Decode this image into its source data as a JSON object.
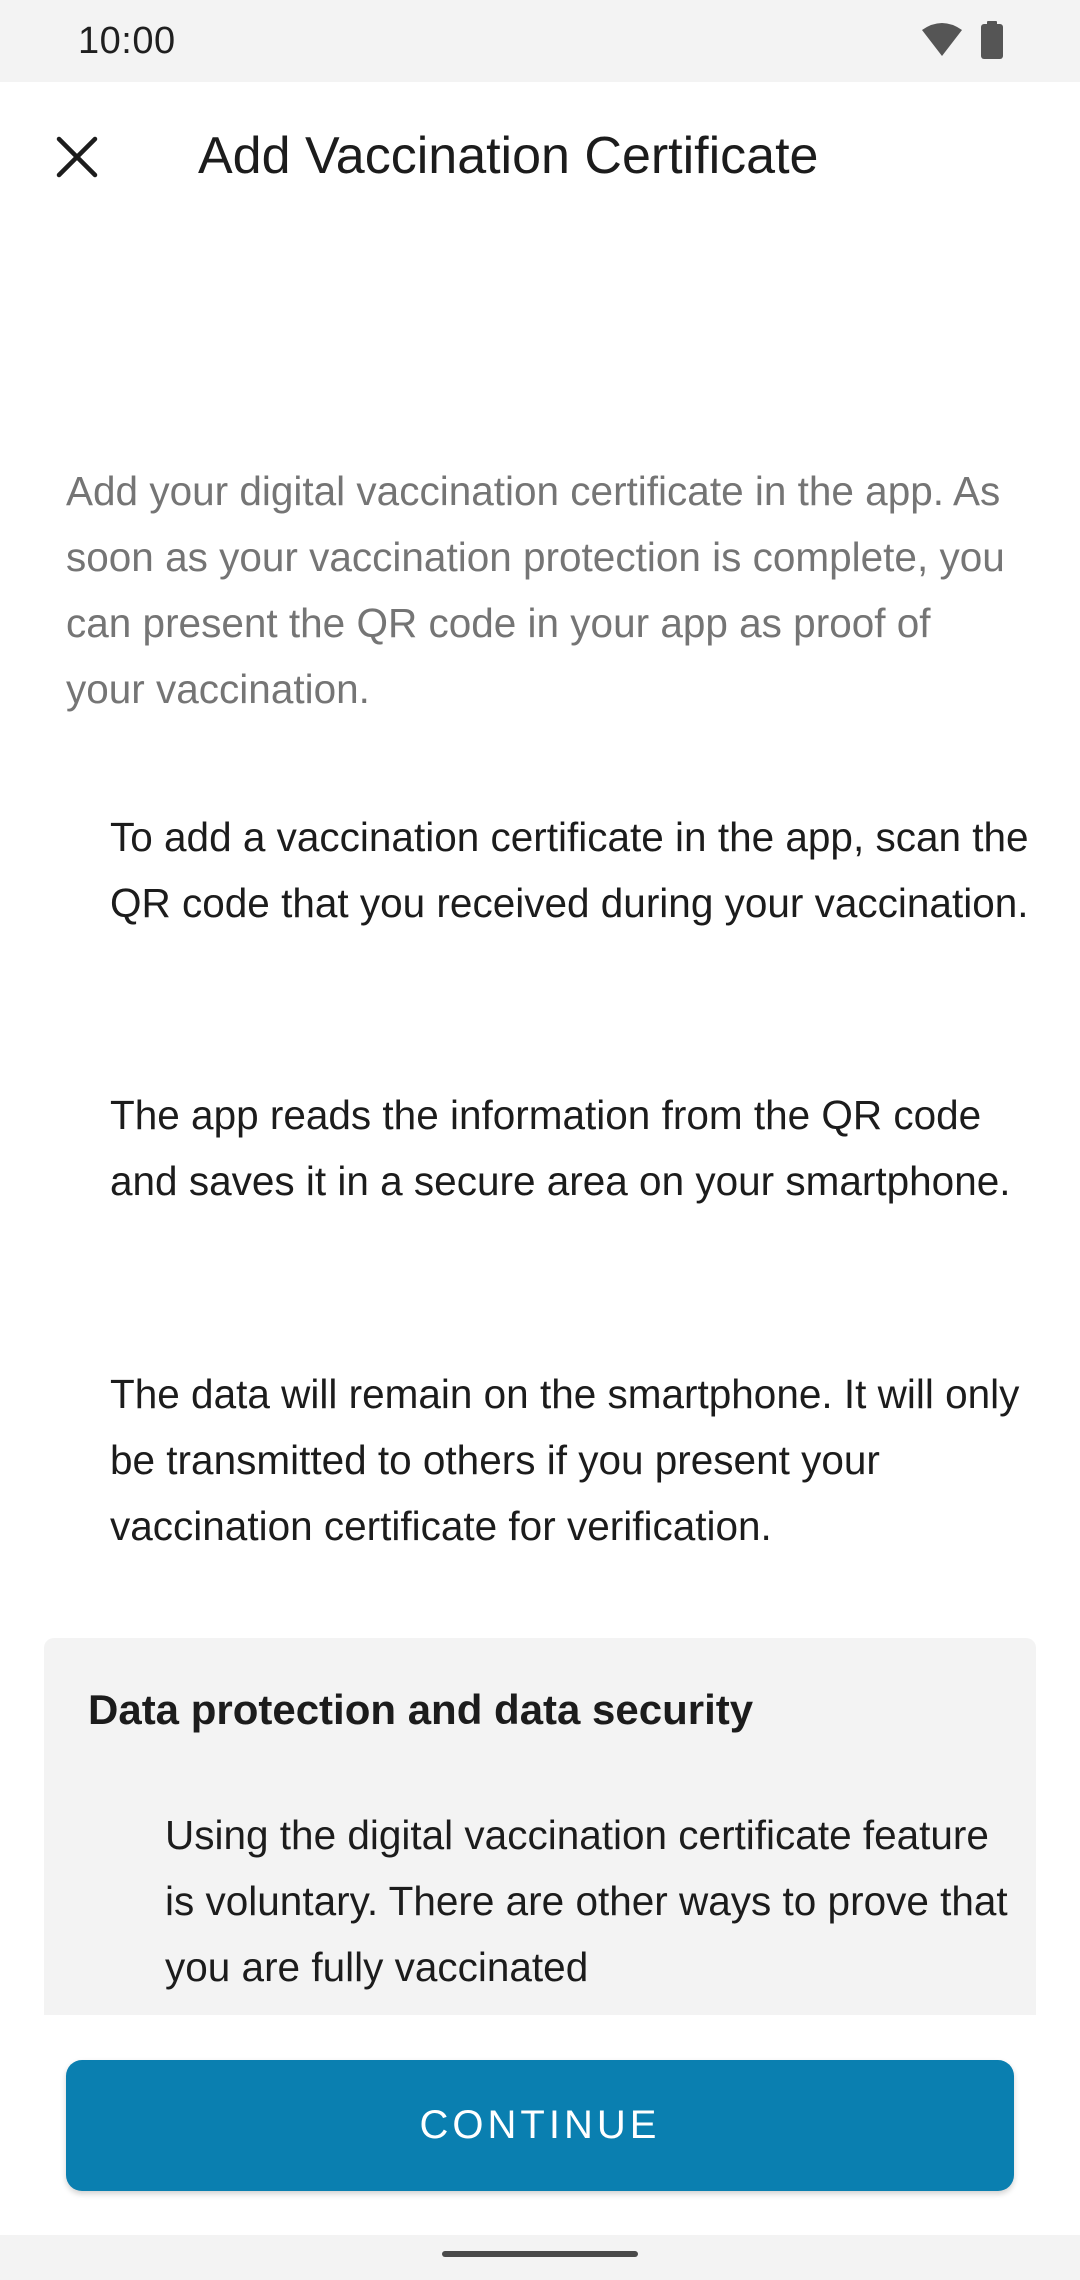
{
  "status_bar": {
    "time": "10:00",
    "icons": [
      "wifi-icon",
      "battery-icon"
    ]
  },
  "header": {
    "title": "Add Vaccination Certificate",
    "close_icon": "close-icon"
  },
  "content": {
    "intro": "Add your digital vaccination certificate in the app. As soon as your vaccination protection is complete, you can present the QR code in your app as proof of your vaccination.",
    "paragraphs": [
      "To add a vaccination certificate in the app, scan the QR code that you received during your vaccination.",
      "The app reads the information from the QR code and saves it in a secure area on your smartphone.",
      "The data will remain on the smartphone. It will only be transmitted to others if you present your vaccination certificate for verification."
    ],
    "privacy": {
      "title": "Data protection and data security",
      "text": "Using the digital vaccination certificate feature is voluntary. There are other ways to prove that you are fully vaccinated"
    }
  },
  "footer": {
    "continue_label": "CONTINUE"
  },
  "colors": {
    "accent": "#0a7fb0",
    "muted_text": "#757575",
    "panel_bg": "#f3f3f3"
  }
}
